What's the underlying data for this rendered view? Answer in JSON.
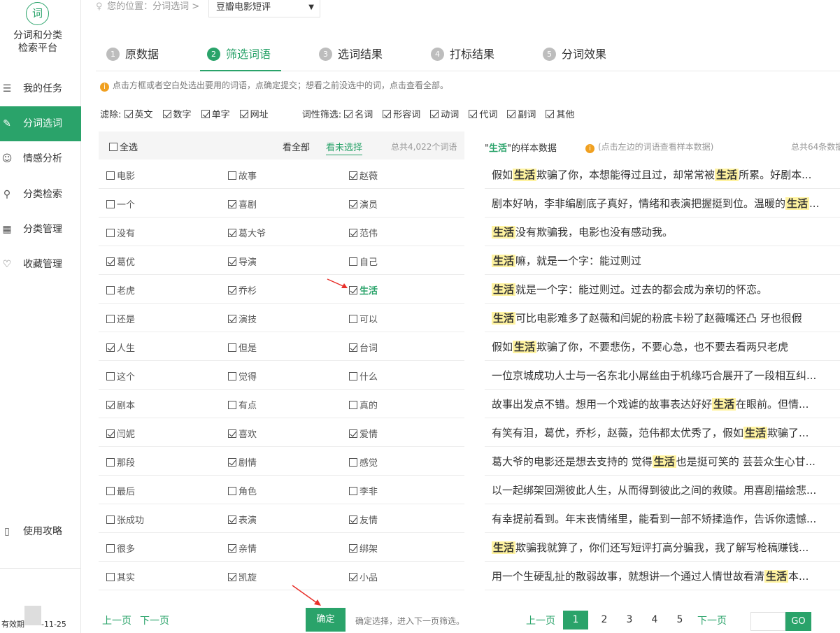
{
  "app": {
    "logo_char": "词",
    "logo_line1": "分词和分类",
    "logo_line2": "检索平台"
  },
  "sidebar": {
    "items": [
      {
        "label": "我的任务",
        "icon": "list-icon"
      },
      {
        "label": "分词选词",
        "icon": "edit-icon"
      },
      {
        "label": "情感分析",
        "icon": "smile-icon"
      },
      {
        "label": "分类检索",
        "icon": "search-icon"
      },
      {
        "label": "分类管理",
        "icon": "grid-icon"
      },
      {
        "label": "收藏管理",
        "icon": "heart-icon"
      }
    ],
    "guide_label": "使用攻略",
    "expiry_prefix": "有效期",
    "expiry_suffix": "-11-25"
  },
  "breadcrumb": {
    "location_label": "您的位置：分词选词 >",
    "dataset_selected": "豆瓣电影短评"
  },
  "steps": [
    {
      "num": "1",
      "label": "原数据"
    },
    {
      "num": "2",
      "label": "筛选词语"
    },
    {
      "num": "3",
      "label": "选词结果"
    },
    {
      "num": "4",
      "label": "打标结果"
    },
    {
      "num": "5",
      "label": "分词效果"
    }
  ],
  "tip": "点击方框或者空白处选出要用的词语，点确定提交；想看之前没选中的词，点击查看全部。",
  "filters": {
    "exclude_label": "滤除:",
    "exclude": [
      {
        "label": "英文",
        "checked": true
      },
      {
        "label": "数字",
        "checked": true
      },
      {
        "label": "单字",
        "checked": true
      },
      {
        "label": "网址",
        "checked": true
      }
    ],
    "pos_label": "词性筛选:",
    "pos": [
      {
        "label": "名词",
        "checked": true
      },
      {
        "label": "形容词",
        "checked": true
      },
      {
        "label": "动词",
        "checked": true
      },
      {
        "label": "代词",
        "checked": true
      },
      {
        "label": "副词",
        "checked": true
      },
      {
        "label": "其他",
        "checked": true
      }
    ]
  },
  "word_table": {
    "select_all": "全选",
    "view_all": "看全部",
    "view_unselected": "看未选择",
    "total": "总共4,022个词语",
    "rows": [
      [
        {
          "w": "电影",
          "c": false
        },
        {
          "w": "故事",
          "c": false
        },
        {
          "w": "赵薇",
          "c": true
        }
      ],
      [
        {
          "w": "一个",
          "c": false
        },
        {
          "w": "喜剧",
          "c": true
        },
        {
          "w": "演员",
          "c": true
        }
      ],
      [
        {
          "w": "没有",
          "c": false
        },
        {
          "w": "葛大爷",
          "c": true
        },
        {
          "w": "范伟",
          "c": true
        }
      ],
      [
        {
          "w": "葛优",
          "c": true
        },
        {
          "w": "导演",
          "c": true
        },
        {
          "w": "自己",
          "c": false
        }
      ],
      [
        {
          "w": "老虎",
          "c": false
        },
        {
          "w": "乔杉",
          "c": true
        },
        {
          "w": "生活",
          "c": true,
          "hl": true
        }
      ],
      [
        {
          "w": "还是",
          "c": false
        },
        {
          "w": "演技",
          "c": true
        },
        {
          "w": "可以",
          "c": false
        }
      ],
      [
        {
          "w": "人生",
          "c": true
        },
        {
          "w": "但是",
          "c": false
        },
        {
          "w": "台词",
          "c": true
        }
      ],
      [
        {
          "w": "这个",
          "c": false
        },
        {
          "w": "觉得",
          "c": false
        },
        {
          "w": "什么",
          "c": false
        }
      ],
      [
        {
          "w": "剧本",
          "c": true
        },
        {
          "w": "有点",
          "c": false
        },
        {
          "w": "真的",
          "c": false
        }
      ],
      [
        {
          "w": "闫妮",
          "c": true
        },
        {
          "w": "喜欢",
          "c": true
        },
        {
          "w": "爱情",
          "c": true
        }
      ],
      [
        {
          "w": "那段",
          "c": false
        },
        {
          "w": "剧情",
          "c": true
        },
        {
          "w": "感觉",
          "c": false
        }
      ],
      [
        {
          "w": "最后",
          "c": false
        },
        {
          "w": "角色",
          "c": false
        },
        {
          "w": "李非",
          "c": false
        }
      ],
      [
        {
          "w": "张成功",
          "c": false
        },
        {
          "w": "表演",
          "c": true
        },
        {
          "w": "友情",
          "c": true
        }
      ],
      [
        {
          "w": "很多",
          "c": false
        },
        {
          "w": "亲情",
          "c": true
        },
        {
          "w": "绑架",
          "c": true
        }
      ],
      [
        {
          "w": "其实",
          "c": false
        },
        {
          "w": "凯旋",
          "c": true
        },
        {
          "w": "小品",
          "c": true
        }
      ]
    ]
  },
  "sample_panel": {
    "keyword": "生活",
    "title_suffix": "的样本数据",
    "tip": "(点击左边的词语查看样本数据)",
    "total": "总共64条数据",
    "rows": [
      [
        "假如",
        "生活",
        "欺骗了你，本想能得过且过，却常常被",
        "生活",
        "所累。好剧本..."
      ],
      [
        "剧本好呐，李非编剧底子真好，情绪和表演把握挺到位。温暖的",
        "生活",
        "..."
      ],
      [
        "",
        "生活",
        "没有欺骗我，电影也没有感动我。"
      ],
      [
        "",
        "生活",
        "嘛，就是一个字：能过则过"
      ],
      [
        "",
        "生活",
        "就是一个字：能过则过。过去的都会成为亲切的怀恋。"
      ],
      [
        "",
        "生活",
        "可比电影难多了赵薇和闫妮的粉底卡粉了赵薇嘴还凸 牙也很假"
      ],
      [
        "假如",
        "生活",
        "欺骗了你，不要悲伤，不要心急，也不要去看两只老虎"
      ],
      [
        "一位京城成功人士与一名东北小屌丝由于机缘巧合展开了一段相互纠..."
      ],
      [
        "故事出发点不错。想用一个戏谑的故事表达好好",
        "生活",
        "在眼前。但情..."
      ],
      [
        "有笑有泪，葛优，乔杉，赵薇，范伟都太优秀了，假如",
        "生活",
        "欺骗了..."
      ],
      [
        "葛大爷的电影还是想去支持的 觉得",
        "生活",
        "也是挺可笑的 芸芸众生心甘..."
      ],
      [
        "以一起绑架回溯彼此人生，从而得到彼此之间的救赎。用喜剧描绘悲..."
      ],
      [
        "有幸提前看到。年末丧情绪里，能看到一部不矫揉造作，告诉你遗憾..."
      ],
      [
        "",
        "生活",
        "欺骗我就算了，你们还写短评打高分骗我，我了解写枪稿赚钱..."
      ],
      [
        "用一个生硬乱扯的散弱故事，就想讲一个通过人情世故看清",
        "生活",
        "本..."
      ]
    ]
  },
  "bottom": {
    "prev": "上一页",
    "next": "下一页",
    "confirm": "确定",
    "confirm_tip": "确定选择，进入下一页筛选。",
    "pages": [
      "1",
      "2",
      "3",
      "4",
      "5"
    ],
    "current_page": "1",
    "go": "GO"
  },
  "colors": {
    "accent": "#2aa36a",
    "highlight": "#fff3a0",
    "arrow": "#e8302a"
  }
}
